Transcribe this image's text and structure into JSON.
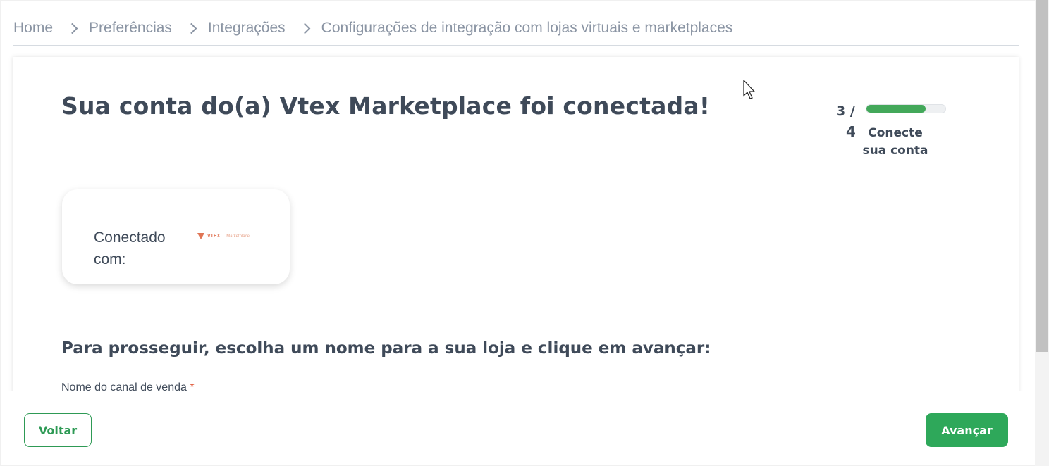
{
  "breadcrumb": {
    "items": [
      "Home",
      "Preferências",
      "Integrações",
      "Configurações de integração com lojas virtuais e marketplaces"
    ]
  },
  "main": {
    "title": "Sua conta do(a) Vtex Marketplace foi conectada!",
    "step": {
      "current": "3 /",
      "total": "4",
      "label": "Conecte sua conta",
      "progress_fraction": 0.75
    },
    "connection": {
      "label": "Conectado com:",
      "logo_text": "VTEX",
      "logo_sub": "Marketplace"
    },
    "section_title": "Para prosseguir, escolha um nome para a sua loja e clique em avançar:",
    "field": {
      "label": "Nome do canal de venda",
      "required_mark": "*"
    }
  },
  "footer": {
    "back_label": "Voltar",
    "next_label": "Avançar"
  },
  "colors": {
    "primary": "#2ea85a",
    "text": "#3f4a59",
    "muted": "#8a94a3"
  }
}
